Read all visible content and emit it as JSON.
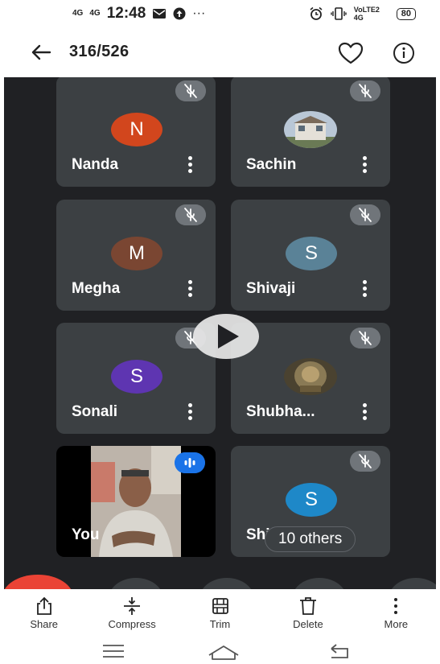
{
  "status_bar": {
    "signal_1": "4G",
    "signal_2": "4G",
    "time": "12:48",
    "battery": "80",
    "network": "VoLTE2 4G",
    "icons": [
      "mail-icon",
      "upload-icon",
      "more-notifications-icon",
      "alarm-icon",
      "vibrate-icon",
      "battery-icon"
    ]
  },
  "header": {
    "counter": "316/526",
    "icons": [
      "back-arrow-icon",
      "heart-icon",
      "info-icon"
    ]
  },
  "participants": [
    {
      "name": "Nanda",
      "initial": "N",
      "avatar_color": "#d2461d",
      "muted": true
    },
    {
      "name": "Sachin",
      "initial": "",
      "avatar_type": "photo-house",
      "muted": true
    },
    {
      "name": "Megha",
      "initial": "M",
      "avatar_color": "#7a4632",
      "muted": true
    },
    {
      "name": "Shivaji",
      "initial": "S",
      "avatar_color": "#5a8297",
      "muted": true
    },
    {
      "name": "Sonali",
      "initial": "S",
      "avatar_color": "#5e35b1",
      "muted": true
    },
    {
      "name": "Shubha...",
      "initial": "",
      "avatar_type": "photo-deity",
      "muted": true
    },
    {
      "name": "Shi",
      "initial": "S",
      "avatar_color": "#1e88c8",
      "muted": true
    }
  ],
  "self_tile": {
    "name": "You",
    "speaking": true
  },
  "others_badge": "10 others",
  "toolbar": {
    "items": [
      {
        "label": "Share",
        "icon": "share-icon"
      },
      {
        "label": "Compress",
        "icon": "compress-icon"
      },
      {
        "label": "Trim",
        "icon": "trim-icon"
      },
      {
        "label": "Delete",
        "icon": "delete-icon"
      },
      {
        "label": "More",
        "icon": "more-vertical-icon"
      }
    ]
  },
  "nav_bar": {
    "icons": [
      "recent-apps-icon",
      "home-icon",
      "back-icon"
    ]
  },
  "colors": {
    "video_bg": "#202124",
    "tile_bg": "#3c4043",
    "speaking": "#1a73e8",
    "end_call": "#ea4335"
  }
}
